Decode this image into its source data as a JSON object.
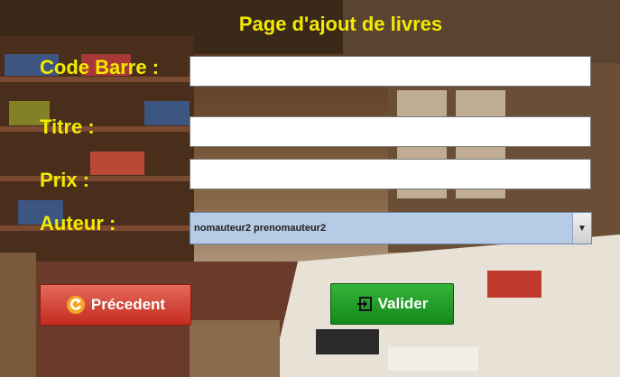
{
  "window": {
    "title": "Page d'ajout de livres"
  },
  "form": {
    "barcode_label": "Code Barre :",
    "barcode_value": "",
    "title_label": "Titre :",
    "title_value": "",
    "price_label": "Prix :",
    "price_value": "",
    "author_label": "Auteur :",
    "author_selected": "nomauteur2 prenomauteur2"
  },
  "buttons": {
    "previous_label": "Précedent",
    "previous_icon": "back-arrow-icon",
    "validate_label": "Valider",
    "validate_icon": "login-arrow-icon"
  },
  "colors": {
    "label_yellow": "#f2ea00",
    "previous_red": "#d23a2e",
    "validate_green": "#1f9c24",
    "combo_blue": "#b6cbe6"
  }
}
